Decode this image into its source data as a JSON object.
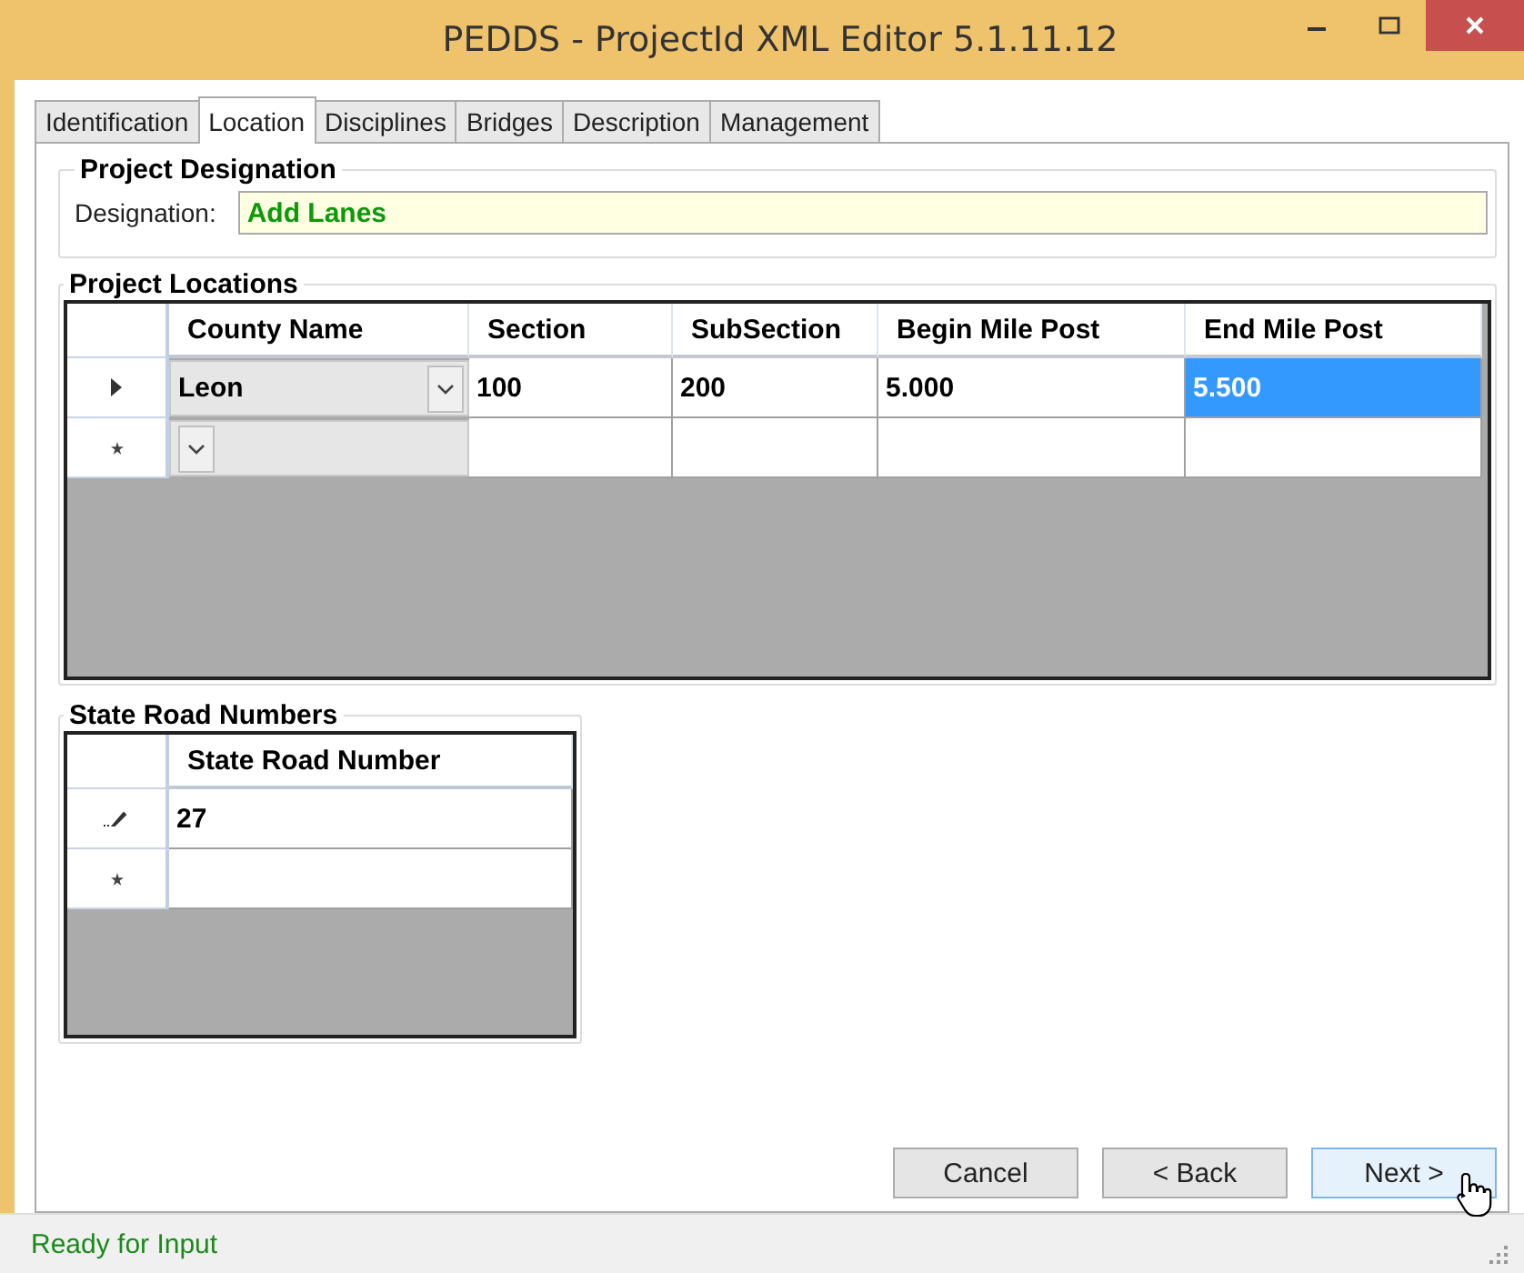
{
  "window": {
    "title": "PEDDS - ProjectId XML Editor 5.1.11.12"
  },
  "tabs": [
    {
      "label": "Identification",
      "selected": false
    },
    {
      "label": "Location",
      "selected": true
    },
    {
      "label": "Disciplines",
      "selected": false
    },
    {
      "label": "Bridges",
      "selected": false
    },
    {
      "label": "Description",
      "selected": false
    },
    {
      "label": "Management",
      "selected": false
    }
  ],
  "project_designation": {
    "title": "Project Designation",
    "label": "Designation:",
    "value": "Add Lanes"
  },
  "project_locations": {
    "title": "Project Locations",
    "columns": [
      "County Name",
      "Section",
      "SubSection",
      "Begin Mile Post",
      "End Mile Post"
    ],
    "rows": [
      {
        "kind": "current",
        "cells": [
          {
            "text": "Leon",
            "selected": false
          },
          {
            "text": "100",
            "selected": false
          },
          {
            "text": "200",
            "selected": false
          },
          {
            "text": "5.000",
            "selected": false
          },
          {
            "text": "5.500",
            "selected": true
          }
        ]
      },
      {
        "kind": "new"
      }
    ]
  },
  "state_road_numbers": {
    "title": "State Road Numbers",
    "columns": [
      "State Road Number"
    ],
    "rows": [
      {
        "kind": "editing",
        "cells": [
          {
            "text": "27",
            "selected": false
          }
        ]
      },
      {
        "kind": "new"
      }
    ]
  },
  "buttons": [
    {
      "label": "Cancel",
      "hovered": false
    },
    {
      "label": "< Back",
      "hovered": false
    },
    {
      "label": "Next >",
      "hovered": true
    }
  ],
  "status_bar": {
    "text": "Ready for Input"
  }
}
